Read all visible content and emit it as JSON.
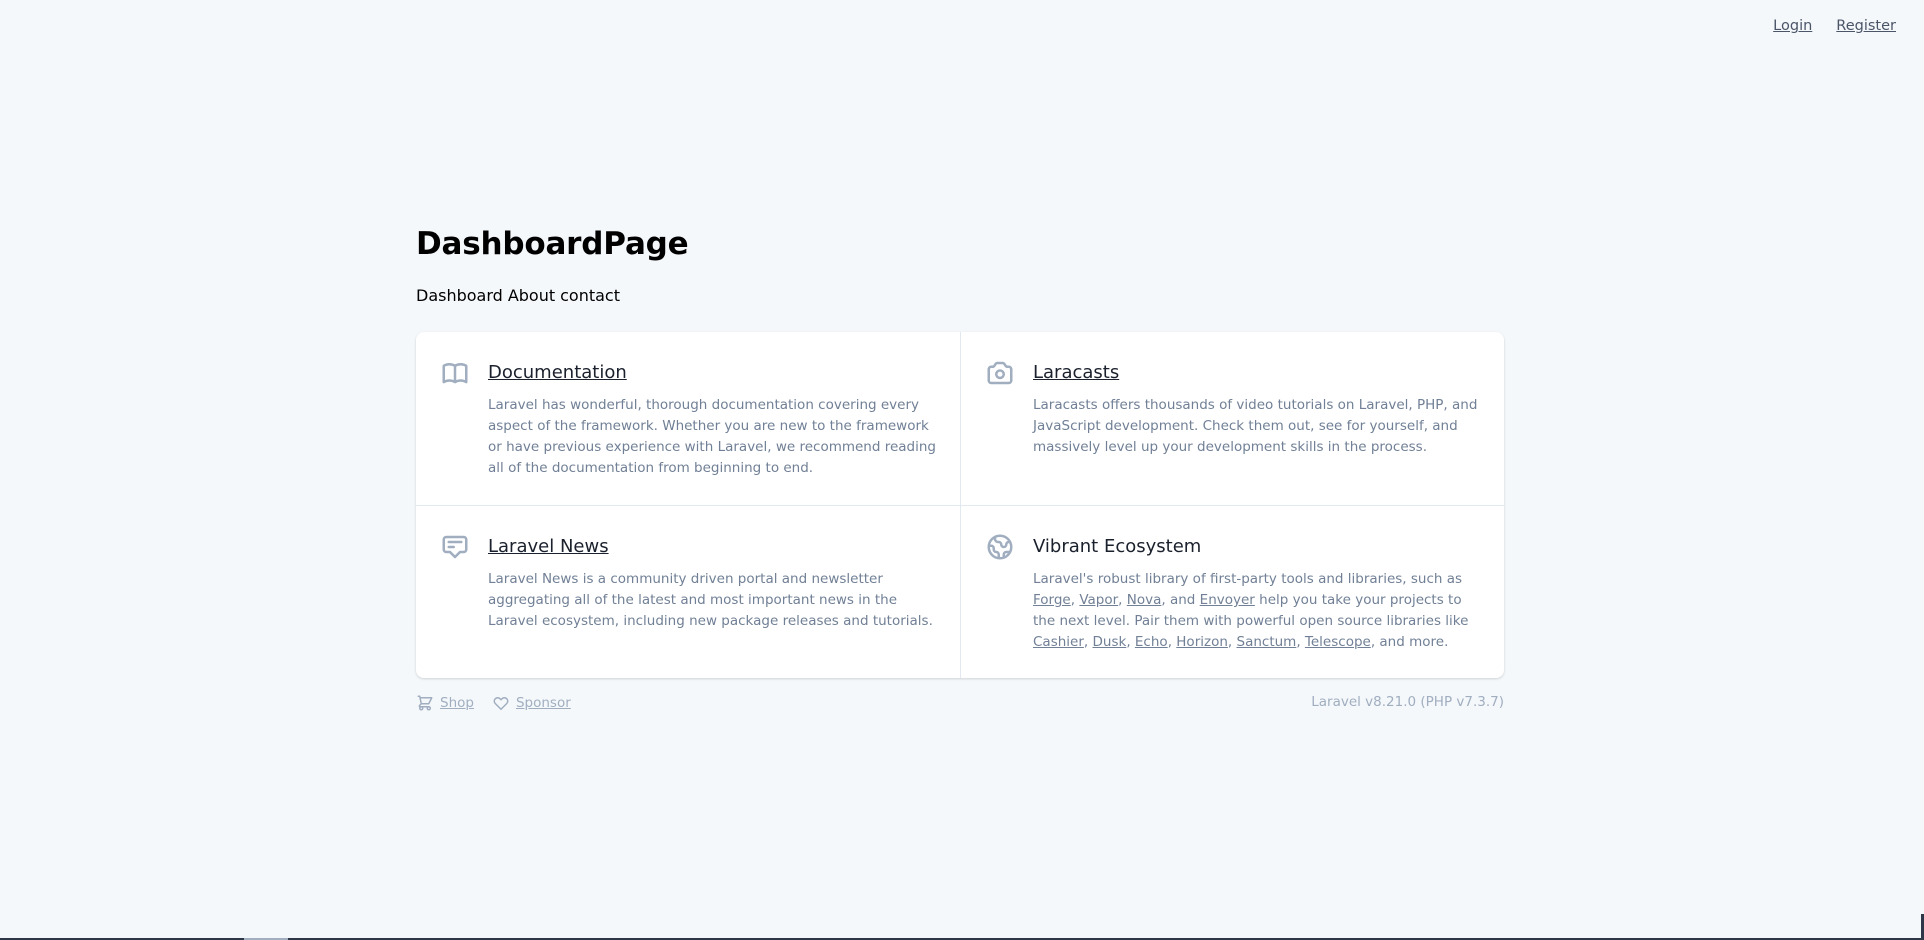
{
  "topnav": {
    "login": "Login",
    "register": "Register"
  },
  "page_title": "DashboardPage",
  "subnav": [
    "Dashboard",
    "About",
    "contact"
  ],
  "cards": {
    "documentation": {
      "icon": "book-icon",
      "title": "Documentation",
      "text": "Laravel has wonderful, thorough documentation covering every aspect of the framework. Whether you are new to the framework or have previous experience with Laravel, we recommend reading all of the documentation from beginning to end."
    },
    "laracasts": {
      "icon": "camera-icon",
      "title": "Laracasts",
      "text": "Laracasts offers thousands of video tutorials on Laravel, PHP, and JavaScript development. Check them out, see for yourself, and massively level up your development skills in the process."
    },
    "news": {
      "icon": "chat-bubble-icon",
      "title": "Laravel News",
      "text": "Laravel News is a community driven portal and newsletter aggregating all of the latest and most important news in the Laravel ecosystem, including new package releases and tutorials."
    },
    "ecosystem": {
      "icon": "globe-icon",
      "title": "Vibrant Ecosystem",
      "text_a": "Laravel's robust library of first-party tools and libraries, such as ",
      "text_b": " help you take your projects to the next level. Pair them with powerful open source libraries like ",
      "text_c": ", and more.",
      "links_a": [
        "Forge",
        "Vapor",
        "Nova",
        "Envoyer"
      ],
      "links_b": [
        "Cashier",
        "Dusk",
        "Echo",
        "Horizon",
        "Sanctum",
        "Telescope"
      ],
      "sep_comma": ", ",
      "sep_and": ", and "
    }
  },
  "footer": {
    "shop": "Shop",
    "sponsor": "Sponsor",
    "version": "Laravel v8.21.0 (PHP v7.3.7)"
  },
  "colors": {
    "background": "#f5f8fb",
    "muted": "#718096",
    "faint": "#a0aec0"
  }
}
